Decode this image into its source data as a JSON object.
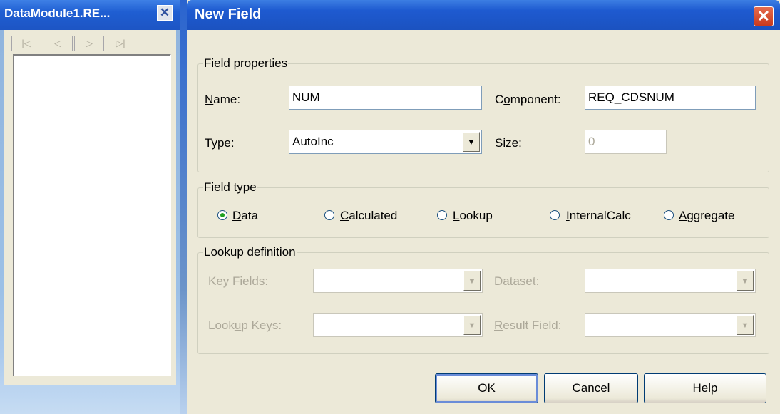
{
  "left_window": {
    "title": "DataModule1.RE...",
    "close_glyph": "✕",
    "nav_buttons": [
      {
        "name": "first",
        "glyph": "|◁"
      },
      {
        "name": "prior",
        "glyph": "◁"
      },
      {
        "name": "next",
        "glyph": "▷"
      },
      {
        "name": "last",
        "glyph": "▷|"
      }
    ]
  },
  "dialog": {
    "title": "New Field",
    "close_glyph": "✕",
    "field_properties": {
      "legend": "Field properties",
      "name_label_u": "N",
      "name_label_rest": "ame:",
      "name_value": "NUM",
      "component_label_pre": "C",
      "component_label_u": "o",
      "component_label_rest": "mponent:",
      "component_value": "REQ_CDSNUM",
      "type_label_u": "T",
      "type_label_rest": "ype:",
      "type_value": "AutoInc",
      "size_label_u": "S",
      "size_label_rest": "ize:",
      "size_value": "0"
    },
    "field_type": {
      "legend": "Field type",
      "options": [
        {
          "u": "D",
          "rest": "ata",
          "selected": true
        },
        {
          "u": "C",
          "rest": "alculated",
          "selected": false
        },
        {
          "u": "L",
          "rest": "ookup",
          "selected": false
        },
        {
          "u": "I",
          "rest": "nternalCalc",
          "selected": false
        },
        {
          "u": "A",
          "rest": "ggregate",
          "selected": false
        }
      ]
    },
    "lookup_definition": {
      "legend": "Lookup definition",
      "key_fields_u": "K",
      "key_fields_rest": "ey Fields:",
      "dataset_pre": "D",
      "dataset_u": "a",
      "dataset_rest": "taset:",
      "lookup_keys_pre": "Look",
      "lookup_keys_u": "u",
      "lookup_keys_rest": "p Keys:",
      "result_field_u": "R",
      "result_field_rest": "esult Field:"
    },
    "buttons": {
      "ok": "OK",
      "cancel": "Cancel",
      "help_u": "H",
      "help_rest": "elp"
    }
  },
  "colors": {
    "title_bar": "#1f5ed2",
    "face": "#ece9d8",
    "disabled_text": "#aca899"
  },
  "icons": {
    "dropdown": "▼"
  }
}
